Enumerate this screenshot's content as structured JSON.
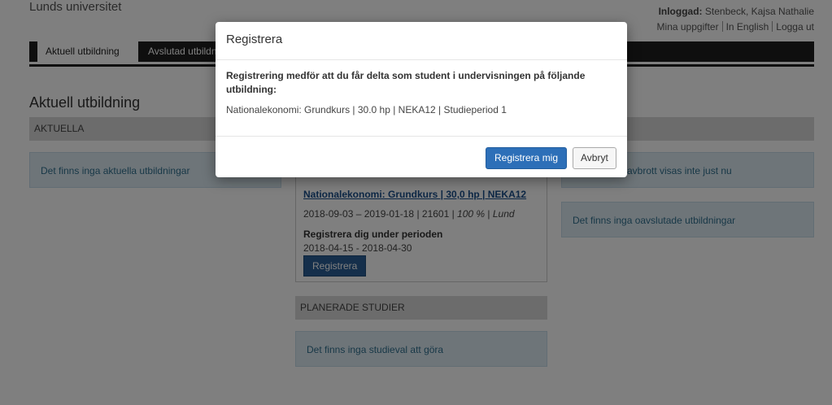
{
  "header": {
    "brand": "Lunds universitet",
    "logged_in_label": "Inloggad:",
    "user_name": "Stenbeck, Kajsa Nathalie",
    "links": [
      "Mina uppgifter",
      "In English",
      "Logga ut"
    ]
  },
  "nav": {
    "tabs": [
      "Aktuell utbildning",
      "Avslutad utbildning"
    ]
  },
  "main": {
    "title": "Aktuell utbildning",
    "col_current": {
      "heading": "AKTUELLA",
      "empty": "Det finns inga aktuella utbildningar"
    },
    "col_middle": {
      "course_link": "Nationalekonomi: Grundkurs | 30,0 hp | NEKA12",
      "dates": "2018-09-03 – 2019-01-18 | 21601 | ",
      "pace": "100 %",
      "place_sep": " | ",
      "place": "Lund",
      "reg_title": "Registrera dig under perioden",
      "reg_dates": "2018-04-15 - 2018-04-30",
      "reg_button": "Registrera",
      "planned_heading": "PLANERADE STUDIER",
      "planned_empty": "Det finns inga studieval att göra"
    },
    "col_right": {
      "aborted_text": "avbrott visas inte just nu",
      "finished_empty": "Det finns inga oavslutade utbildningar"
    }
  },
  "modal": {
    "title": "Registrera",
    "lead": "Registrering medför att du får delta som student i undervisningen på följande utbildning:",
    "course": "Nationalekonomi: Grundkurs | 30.0 hp | NEKA12 | Studieperiod 1",
    "confirm_button": "Registrera mig",
    "cancel_button": "Avbryt"
  }
}
